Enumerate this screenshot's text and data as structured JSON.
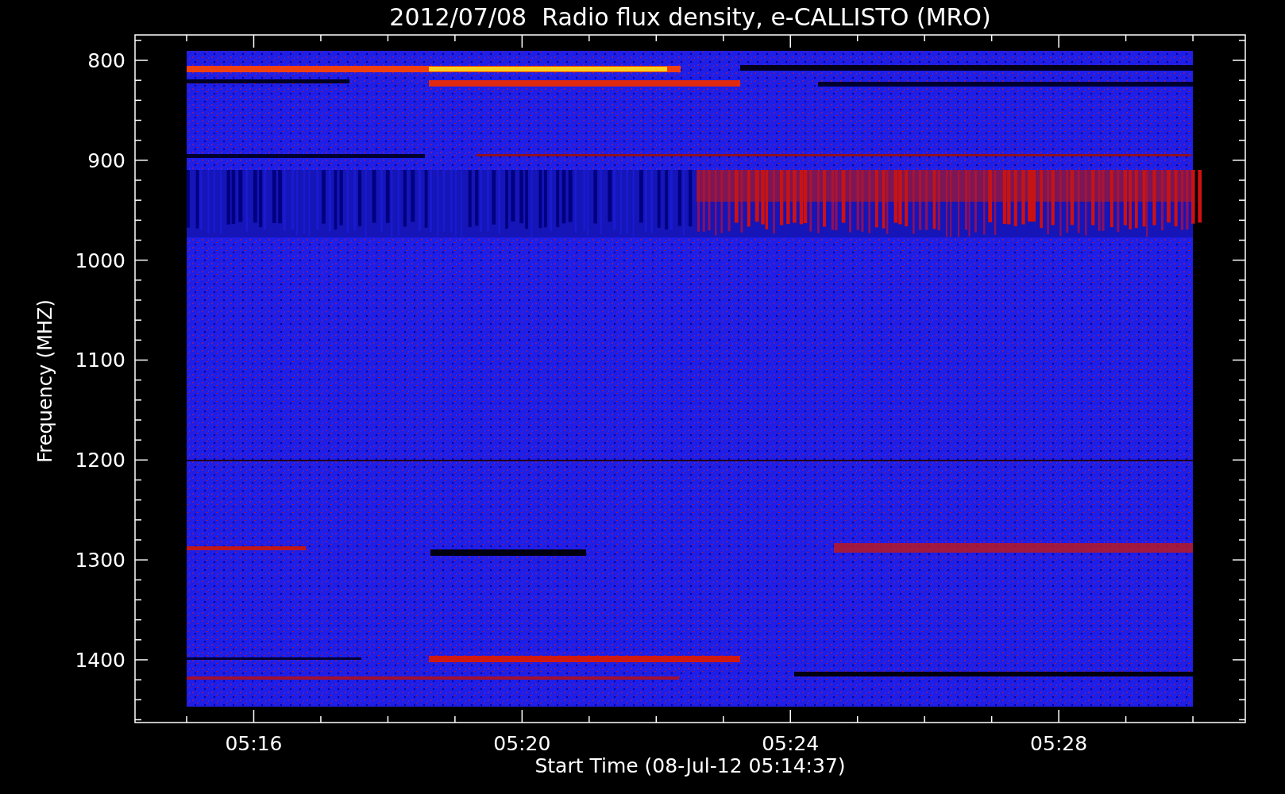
{
  "plot": {
    "title": "2012/07/08  Radio flux density, e-CALLISTO (MRO)",
    "ylabel": "Frequency (MHZ)",
    "xlabel": "Start Time (08-Jul-12 05:14:37)",
    "yticks": [
      "800",
      "900",
      "1000",
      "1100",
      "1200",
      "1300",
      "1400"
    ],
    "xticks": [
      "05:16",
      "05:20",
      "05:24",
      "05:28"
    ]
  }
}
